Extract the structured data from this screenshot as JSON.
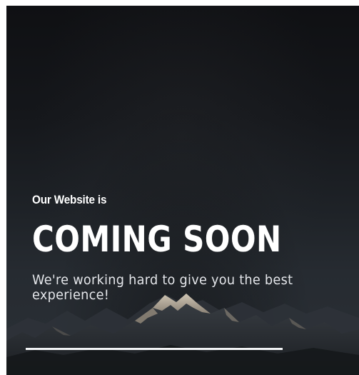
{
  "hero": {
    "intro": "Our Website is",
    "headline": "COMING SOON",
    "tagline": "We're working hard to give you the best experience!"
  },
  "colors": {
    "background": "#15171b",
    "text": "#ffffff",
    "divider": "#f2f3f5"
  },
  "background_image": "snowy-mountain-range"
}
